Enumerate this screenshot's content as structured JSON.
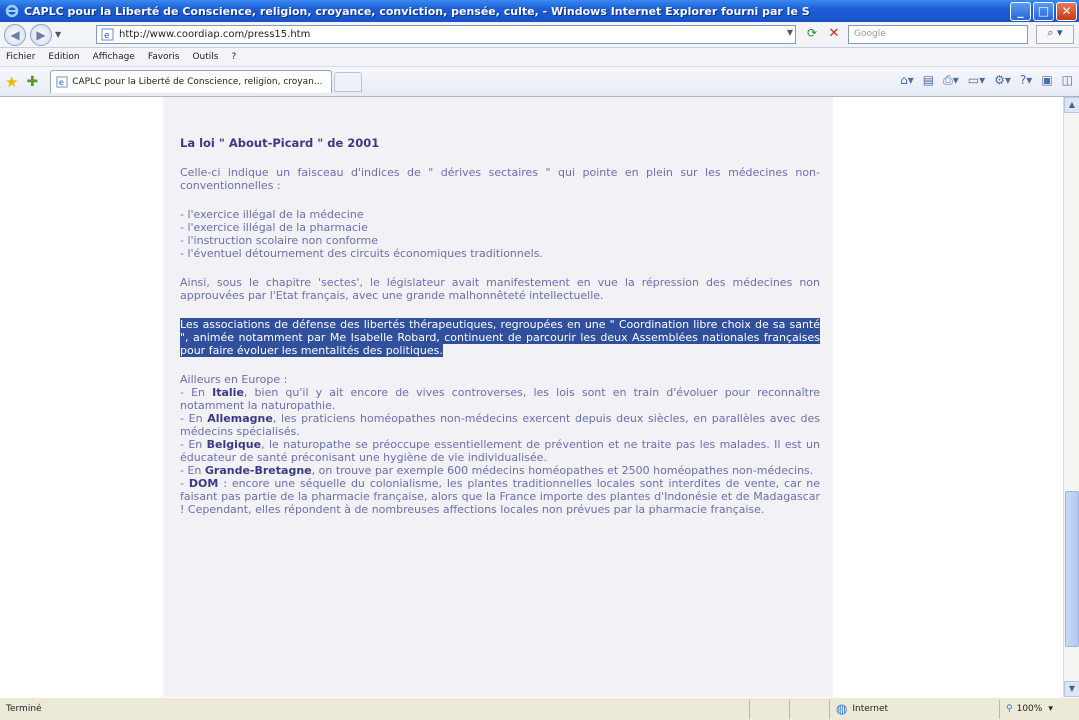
{
  "window": {
    "title": "CAPLC pour la Liberté de Conscience, religion, croyance, conviction, pensée, culte, - Windows Internet Explorer fourni par le S"
  },
  "address": {
    "url": "http://www.coordiap.com/press15.htm",
    "search_placeholder": "Google"
  },
  "menu": [
    "Fichier",
    "Edition",
    "Affichage",
    "Favoris",
    "Outils",
    "?"
  ],
  "tab": {
    "label": "CAPLC pour la Liberté de Conscience, religion, croyan..."
  },
  "article": {
    "heading": "La loi \" About-Picard \" de 2001",
    "intro": "Celle-ci indique un faisceau d'indices de \" dérives sectaires \" qui pointe en plein sur les médecines non-conventionnelles :",
    "list": [
      "- l'exercice illégal de la médecine",
      "- l'exercice illégal de la pharmacie",
      "- l'instruction scolaire non conforme",
      "- l'éventuel détournement des circuits économiques traditionnels."
    ],
    "para2": "Ainsi, sous le chapitre 'sectes', le législateur avait manifestement en vue la répression des médecines non approuvées par l'Etat français, avec une grande malhonnêteté intellectuelle.",
    "highlighted": "Les associations de défense des libertés thérapeutiques, regroupées en une \" Coordination libre choix de sa santé \", animée notamment par Me Isabelle Robard, continuent de parcourir les deux Assemblées nationales françaises pour faire évoluer les mentalités des politiques.",
    "europe_intro": "Ailleurs en Europe :",
    "countries": [
      {
        "prefix": "- En ",
        "name": "Italie",
        "text": ", bien qu'il y ait encore de vives controverses, les lois sont en train d'évoluer pour reconnaître notamment la naturopathie."
      },
      {
        "prefix": "- En ",
        "name": "Allemagne",
        "text": ", les praticiens homéopathes non-médecins exercent depuis deux siècles, en parallèles avec des médecins spécialisés."
      },
      {
        "prefix": "- En ",
        "name": "Belgique",
        "text": ", le naturopathe se préoccupe essentiellement de prévention et ne traite pas les malades. Il est un éducateur de santé préconisant une hygiène de vie individualisée."
      },
      {
        "prefix": "- En ",
        "name": "Grande-Bretagne",
        "text": ", on trouve par exemple 600 médecins homéopathes et 2500 homéopathes non-médecins."
      },
      {
        "prefix": "- ",
        "name": "DOM",
        "text": " : encore une séquelle du colonialisme, les plantes traditionnelles locales sont interdites de vente, car ne faisant pas partie de la pharmacie française, alors que la France importe des plantes d'Indonésie et de Madagascar ! Cependant, elles répondent à de nombreuses affections locales non prévues par la pharmacie française."
      }
    ]
  },
  "status": {
    "left": "Terminé",
    "zone": "Internet",
    "zoom": "100%"
  }
}
